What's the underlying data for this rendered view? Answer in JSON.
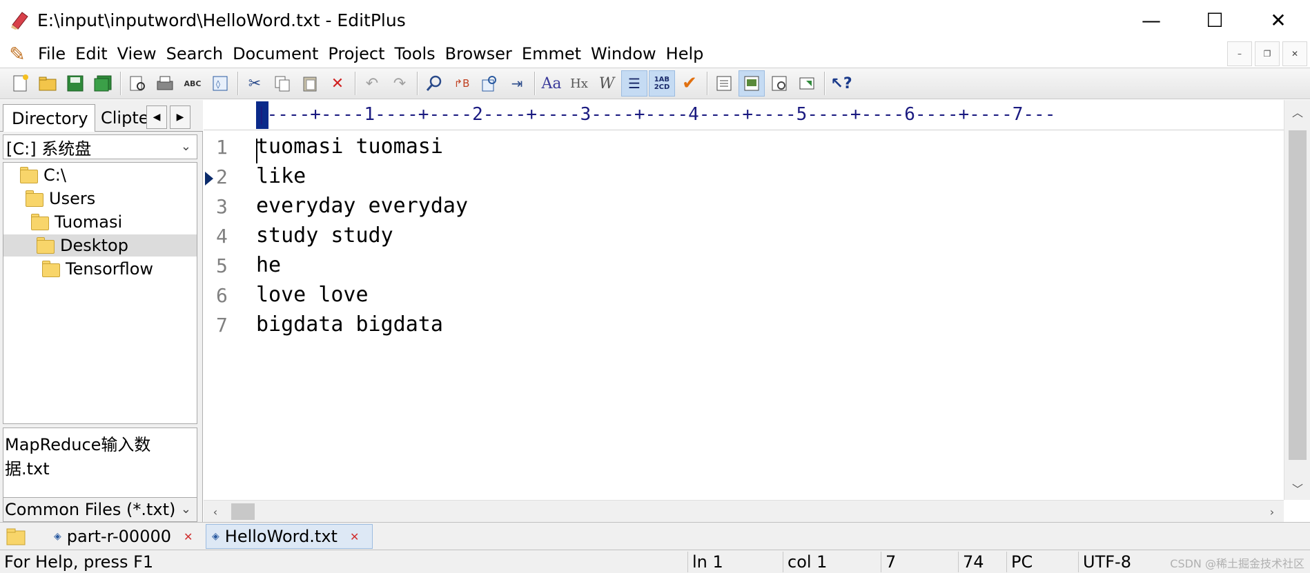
{
  "window": {
    "title": "E:\\input\\inputword\\HelloWord.txt - EditPlus",
    "minimize": "—",
    "maximize": "☐",
    "close": "✕"
  },
  "menu": {
    "items": [
      "File",
      "Edit",
      "View",
      "Search",
      "Document",
      "Project",
      "Tools",
      "Browser",
      "Emmet",
      "Window",
      "Help"
    ]
  },
  "toolbar": {
    "icons": [
      "new-file-icon",
      "open-folder-icon",
      "save-icon",
      "save-all-icon",
      "print-preview-icon",
      "print-icon",
      "spell-check-icon",
      "browser-preview-icon",
      "cut-icon",
      "copy-icon",
      "paste-icon",
      "delete-icon",
      "undo-icon",
      "redo-icon",
      "find-icon",
      "replace-icon",
      "goto-icon",
      "indent-icon",
      "font-icon",
      "hex-icon",
      "word-wrap-icon",
      "line-number-icon",
      "ruler-icon",
      "check-icon",
      "directory-window-icon",
      "cliptext-window-icon",
      "output-window-icon",
      "full-screen-icon",
      "help-icon"
    ]
  },
  "left_panel": {
    "tab_directory": "Directory",
    "tab_cliptext": "Clipte",
    "drive": "[C:] 系统盘",
    "tree": [
      "C:\\",
      "Users",
      "Tuomasi",
      "Desktop",
      "Tensorflow"
    ],
    "selected": "Desktop",
    "files": [
      "MapReduce输入数据.txt"
    ],
    "filter": "Common Files (*.txt)"
  },
  "editor": {
    "ruler": "|----+----1----+----2----+----3----+----4----+----5----+----6----+----7---",
    "lines": [
      {
        "num": "1",
        "text": "tuomasi tuomasi"
      },
      {
        "num": "2",
        "text": "like"
      },
      {
        "num": "3",
        "text": "everyday everyday"
      },
      {
        "num": "4",
        "text": "study study"
      },
      {
        "num": "5",
        "text": "he"
      },
      {
        "num": "6",
        "text": "love love"
      },
      {
        "num": "7",
        "text": "bigdata bigdata"
      }
    ]
  },
  "doc_tabs": [
    {
      "label": "part-r-00000",
      "active": false
    },
    {
      "label": "HelloWord.txt",
      "active": true
    }
  ],
  "status": {
    "help": "For Help, press F1",
    "line": "ln 1",
    "col": "col 1",
    "lines_count": "7",
    "chars": "74",
    "line_ending": "PC",
    "encoding": "UTF-8",
    "watermark": "CSDN @稀土掘金技术社区"
  }
}
